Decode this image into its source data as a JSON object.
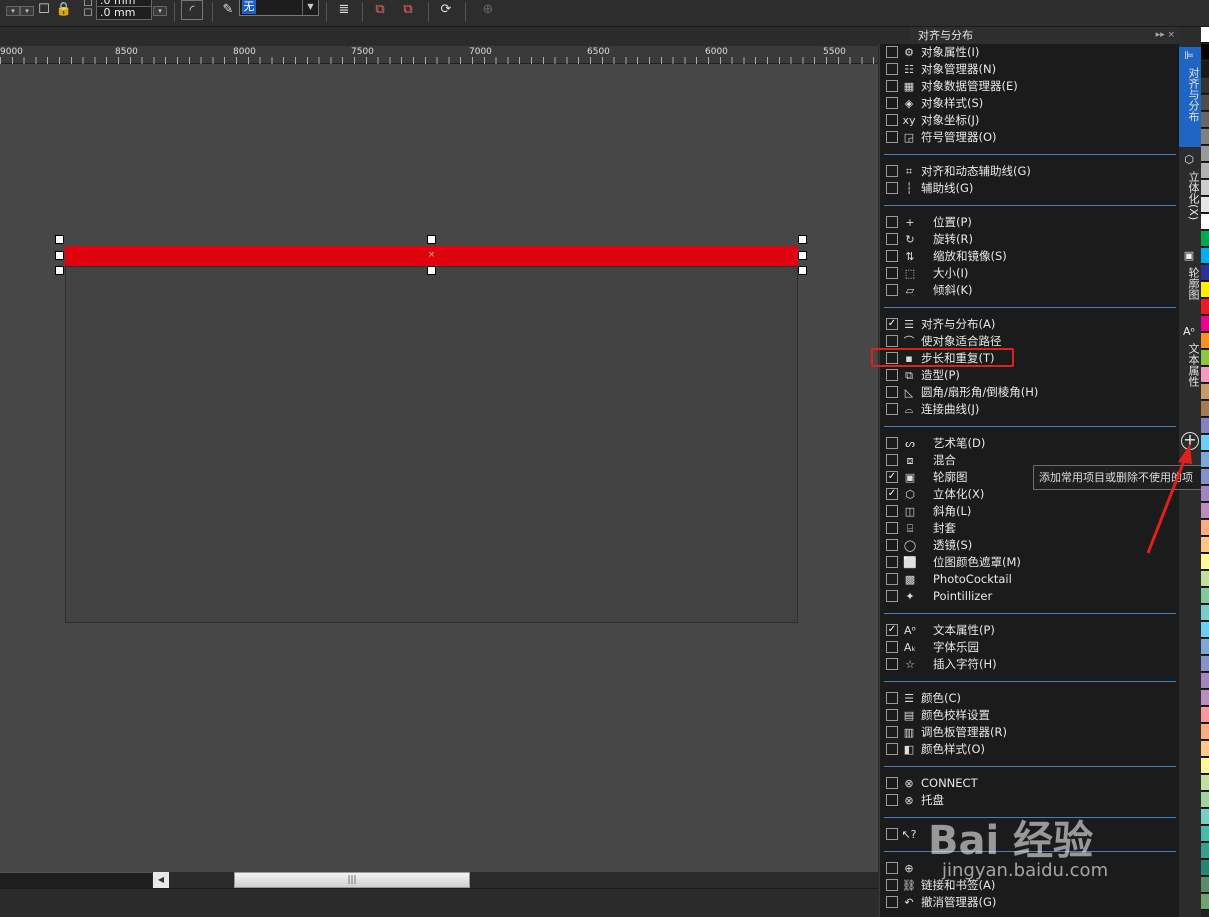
{
  "toolbar": {
    "field_top_value": ".0 mm",
    "field_bottom_value": ".0 mm",
    "outline_select_value": "无"
  },
  "ruler": {
    "labels": [
      "9000",
      "8500",
      "8000",
      "7500",
      "7000",
      "6500",
      "6000",
      "5500"
    ]
  },
  "docker": {
    "title": "对齐与分布",
    "controls": "▸▸ ×"
  },
  "menu_groups": [
    [
      {
        "label": "对象属性(I)",
        "checked": false,
        "icon": "properties-icon"
      },
      {
        "label": "对象管理器(N)",
        "checked": false,
        "icon": "layers-icon"
      },
      {
        "label": "对象数据管理器(E)",
        "checked": false,
        "icon": "data-table-icon"
      },
      {
        "label": "对象样式(S)",
        "checked": false,
        "icon": "style-icon"
      },
      {
        "label": "对象坐标(J)",
        "checked": false,
        "icon": "xy-icon"
      },
      {
        "label": "符号管理器(O)",
        "checked": false,
        "icon": "symbol-icon"
      }
    ],
    [
      {
        "label": "对齐和动态辅助线(G)",
        "checked": false,
        "icon": "snap-guides-icon"
      },
      {
        "label": "辅助线(G)",
        "checked": false,
        "icon": "guides-icon"
      }
    ],
    [
      {
        "label": "位置(P)",
        "checked": false,
        "icon": "position-icon"
      },
      {
        "label": "旋转(R)",
        "checked": false,
        "icon": "rotate-icon"
      },
      {
        "label": "缩放和镜像(S)",
        "checked": false,
        "icon": "scale-mirror-icon"
      },
      {
        "label": "大小(I)",
        "checked": false,
        "icon": "size-icon"
      },
      {
        "label": "倾斜(K)",
        "checked": false,
        "icon": "skew-icon"
      }
    ],
    [
      {
        "label": "对齐与分布(A)",
        "checked": true,
        "icon": "align-icon"
      },
      {
        "label": "使对象适合路径",
        "checked": false,
        "icon": "fit-path-icon"
      },
      {
        "label": "步长和重复(T)",
        "checked": false,
        "icon": "step-repeat-icon"
      },
      {
        "label": "造型(P)",
        "checked": false,
        "icon": "shaping-icon"
      },
      {
        "label": "圆角/扇形角/倒棱角(H)",
        "checked": false,
        "icon": "fillet-icon"
      },
      {
        "label": "连接曲线(J)",
        "checked": false,
        "icon": "join-curves-icon"
      }
    ],
    [
      {
        "label": "艺术笔(D)",
        "checked": false,
        "icon": "artistic-media-icon"
      },
      {
        "label": "混合",
        "checked": false,
        "icon": "blend-icon"
      },
      {
        "label": "轮廓图",
        "checked": true,
        "icon": "contour-icon"
      },
      {
        "label": "立体化(X)",
        "checked": true,
        "icon": "extrude-icon"
      },
      {
        "label": "斜角(L)",
        "checked": false,
        "icon": "bevel-icon"
      },
      {
        "label": "封套",
        "checked": false,
        "icon": "envelope-icon"
      },
      {
        "label": "透镜(S)",
        "checked": false,
        "icon": "lens-icon"
      },
      {
        "label": "位图颜色遮罩(M)",
        "checked": false,
        "icon": "bitmap-mask-icon"
      },
      {
        "label": "PhotoCocktail",
        "checked": false,
        "icon": "photococktail-icon"
      },
      {
        "label": "Pointillizer",
        "checked": false,
        "icon": "pointillizer-icon"
      }
    ],
    [
      {
        "label": "文本属性(P)",
        "checked": true,
        "icon": "text-properties-icon"
      },
      {
        "label": "字体乐园",
        "checked": false,
        "icon": "font-playground-icon"
      },
      {
        "label": "插入字符(H)",
        "checked": false,
        "icon": "star-icon"
      }
    ],
    [
      {
        "label": "颜色(C)",
        "checked": false,
        "icon": "color-icon"
      },
      {
        "label": "颜色校样设置",
        "checked": false,
        "icon": "color-proof-icon"
      },
      {
        "label": "调色板管理器(R)",
        "checked": false,
        "icon": "palette-manager-icon"
      },
      {
        "label": "颜色样式(O)",
        "checked": false,
        "icon": "color-style-icon"
      }
    ],
    [
      {
        "label": "CONNECT",
        "checked": false,
        "icon": "connect-icon"
      },
      {
        "label": "托盘",
        "checked": false,
        "icon": "tray-icon"
      }
    ],
    [
      {
        "label": "",
        "checked": false,
        "icon": "help-pointer-icon"
      }
    ],
    [
      {
        "label": "",
        "checked": false,
        "icon": "globe-icon"
      },
      {
        "label": "链接和书签(A)",
        "checked": false,
        "icon": "link-icon"
      },
      {
        "label": "撤消管理器(G)",
        "checked": false,
        "icon": "undo-icon"
      }
    ]
  ],
  "vertical_tabs": [
    {
      "label": "对齐与分布",
      "active": true
    },
    {
      "label": "立体化(X)",
      "active": false
    },
    {
      "label": "轮廓图",
      "active": false
    },
    {
      "label": "文本属性",
      "active": false
    }
  ],
  "tooltip": "添加常用项目或删除不使用的项",
  "watermark": {
    "logo": "Bai 经验",
    "url": "jingyan.baidu.com"
  },
  "colors": {
    "highlight_box": "#e2201b",
    "active_tab": "#2064c4",
    "selected_object": "#e0030f"
  }
}
